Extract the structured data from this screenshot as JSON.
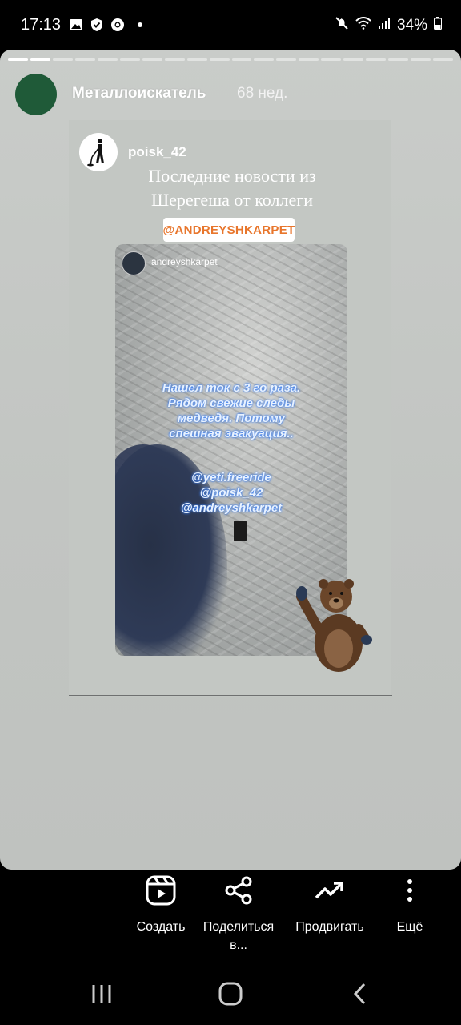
{
  "status_bar": {
    "time": "17:13",
    "battery": "34%",
    "icons_left": [
      "gallery-icon",
      "shield-icon",
      "chrome-icon"
    ],
    "icons_right": [
      "mute-icon",
      "wifi-icon",
      "signal-icon",
      "battery-icon"
    ]
  },
  "story": {
    "progress_total": 20,
    "progress_done": 2,
    "account_name": "Металлоискатель",
    "time_ago": "68 нед.",
    "shared_post": {
      "username": "poisk_42",
      "caption_line1": "Последние новости из",
      "caption_line2": "Шерегеша от коллеги",
      "mention_sticker": "@ANDREYSHKARPET",
      "inner_story": {
        "username": "andreyshkarpet",
        "text_line1": "Нашел ток с 3 го раза.",
        "text_line2": "Рядом свежие следы",
        "text_line3": "медведя. Потому",
        "text_line4": "спешная эвакуация..",
        "tag1": "@yeti.freeride",
        "tag2": "@poisk_42",
        "tag3": "@andreyshkarpet"
      }
    }
  },
  "actions": [
    {
      "label": "Создать",
      "icon": "reels-icon"
    },
    {
      "label": "Поделиться",
      "label2": "в...",
      "icon": "share-icon"
    },
    {
      "label": "Продвигать",
      "icon": "trending-icon"
    },
    {
      "label": "Ещё",
      "icon": "more-vertical-icon"
    }
  ],
  "nav": [
    "recent-apps-icon",
    "home-icon",
    "back-icon"
  ],
  "colors": {
    "avatar_green": "#1f5a38",
    "sticker_orange": "#e8762c",
    "story_bg": "#c4c7c4"
  }
}
